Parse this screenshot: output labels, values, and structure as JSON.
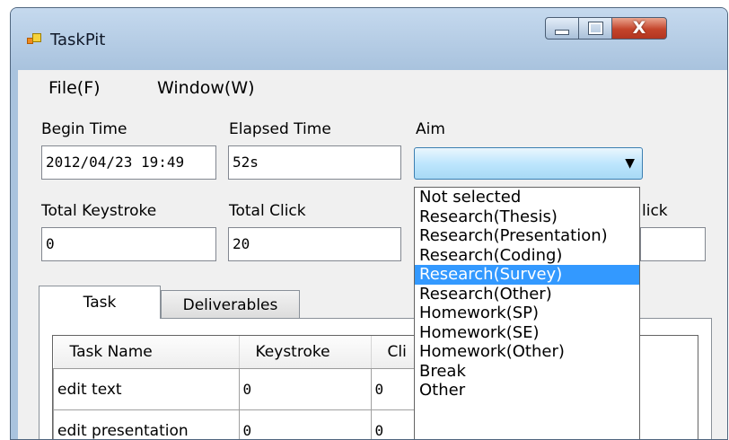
{
  "window": {
    "title": "TaskPit",
    "close_glyph": "X"
  },
  "menu": [
    "File(F)",
    "Window(W)"
  ],
  "fields": {
    "begin_time": {
      "label": "Begin Time",
      "value": "2012/04/23 19:49"
    },
    "elapsed_time": {
      "label": "Elapsed Time",
      "value": "52s"
    },
    "aim": {
      "label": "Aim",
      "value": ""
    },
    "total_keystroke": {
      "label": "Total Keystroke",
      "value": "0"
    },
    "total_click": {
      "label": "Total Click",
      "value": "20"
    },
    "third_partial_label": "lick"
  },
  "aim_options": [
    "Not selected",
    "Research(Thesis)",
    "Research(Presentation)",
    "Research(Coding)",
    "Research(Survey)",
    "Research(Other)",
    "Homework(SP)",
    "Homework(SE)",
    "Homework(Other)",
    "Break",
    "Other"
  ],
  "aim_highlighted_index": 4,
  "tabs": [
    "Task",
    "Deliverables"
  ],
  "task_table": {
    "columns": [
      "Task Name",
      "Keystroke",
      "Cli"
    ],
    "rows": [
      [
        "edit text",
        "0",
        "0"
      ],
      [
        "edit presentation",
        "0",
        "0"
      ]
    ]
  },
  "colors": {
    "selection": "#3399ff",
    "title_bar": "#a9c3de",
    "close_button": "#c4442b"
  },
  "icons": {
    "app": "taskpit-app-icon",
    "dropdown": "chevron-down-icon"
  }
}
